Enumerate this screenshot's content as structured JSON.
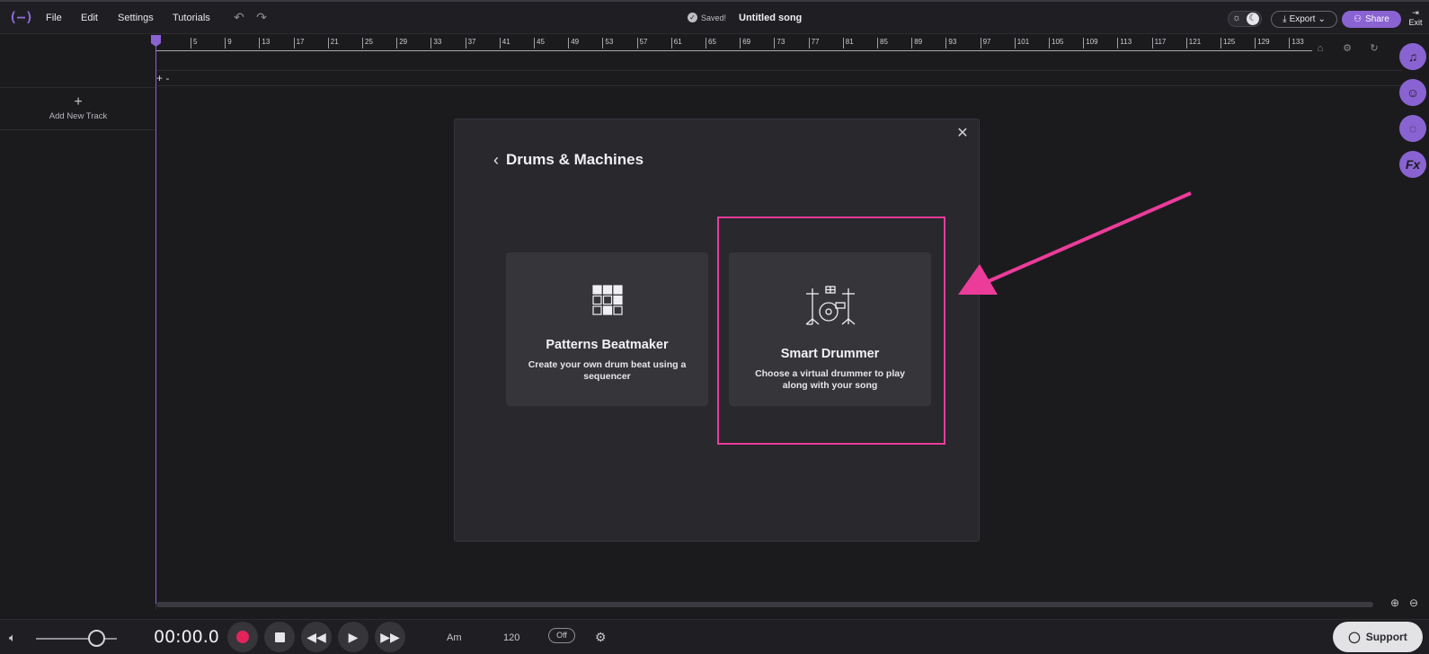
{
  "topbar": {
    "logo_glyph": "(—)",
    "menu": [
      "File",
      "Edit",
      "Settings",
      "Tutorials"
    ],
    "saved_label": "Saved!",
    "song_title": "Untitled song",
    "export_label": "Export",
    "share_label": "Share",
    "exit_label": "Exit"
  },
  "track_panel": {
    "add_track_label": "Add New Track"
  },
  "ruler": {
    "bars": [
      "5",
      "9",
      "13",
      "17",
      "21",
      "25",
      "29",
      "33",
      "37",
      "41",
      "45",
      "49",
      "53",
      "57",
      "61",
      "65",
      "69",
      "73",
      "77",
      "81",
      "85",
      "89",
      "93",
      "97",
      "101",
      "105",
      "109",
      "113",
      "117",
      "121",
      "125",
      "129",
      "133"
    ]
  },
  "modal": {
    "title": "Drums & Machines",
    "cards": [
      {
        "title": "Patterns Beatmaker",
        "description": "Create your own drum beat using a sequencer",
        "icon": "grid-icon"
      },
      {
        "title": "Smart Drummer",
        "description": "Choose a virtual drummer to play along with your song",
        "icon": "drum-kit-icon"
      }
    ]
  },
  "transport": {
    "time": "00:00.0",
    "key": "Am",
    "bpm": "120",
    "metronome": "Off",
    "volume_level": 0.72,
    "support_label": "Support"
  },
  "colors": {
    "accent": "#8a63d2",
    "highlight": "#ec3c9a",
    "record": "#e3245b",
    "background": "#1b1b1e"
  }
}
